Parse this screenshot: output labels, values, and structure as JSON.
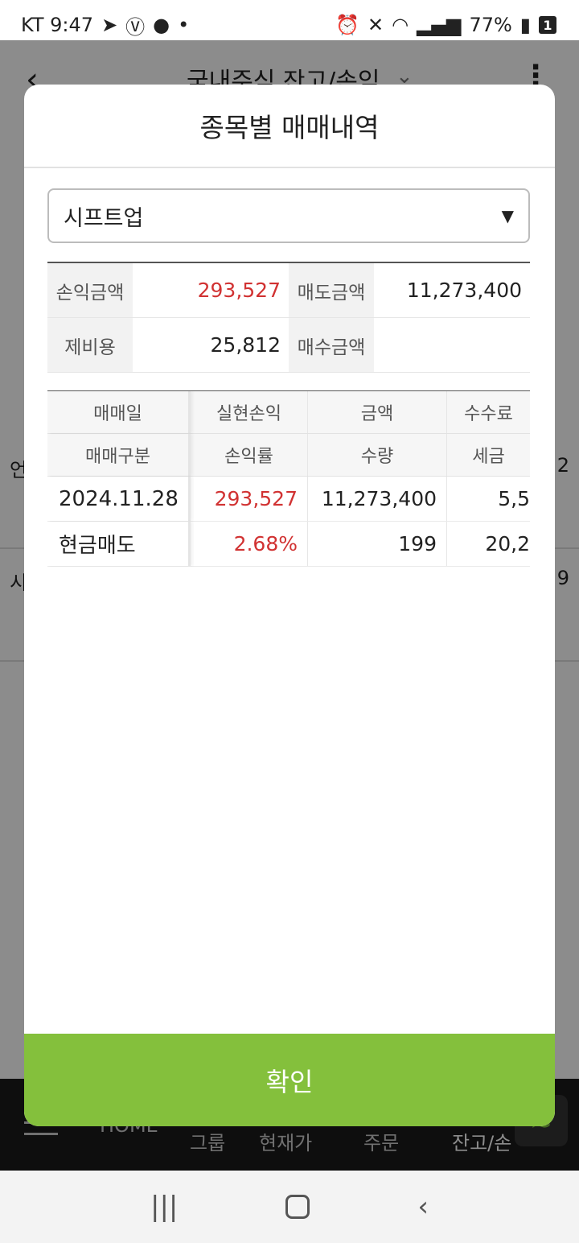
{
  "status_bar": {
    "carrier_time": "KT 9:47",
    "dot": "•",
    "battery": "77%",
    "sim": "1"
  },
  "background_app": {
    "title": "국내주식 잔고/손익",
    "row1_text": "언",
    "row1_num": "2",
    "row2_text": "시",
    "row2_num": "9",
    "nav": {
      "home": "HOME",
      "group": "그룹",
      "price": "현재가",
      "order": "주문",
      "balance": "잔고/손"
    }
  },
  "modal": {
    "title": "종목별 매매내역",
    "stock_select": {
      "value": "시프트업"
    },
    "summary": {
      "profit_label": "손익금액",
      "profit_value": "293,527",
      "sell_label": "매도금액",
      "sell_value": "11,273,400",
      "cost_label": "제비용",
      "cost_value": "25,812",
      "buy_label": "매수금액",
      "buy_value": ""
    },
    "table": {
      "headers_row1": [
        "매매일",
        "실현손익",
        "금액",
        "수수료"
      ],
      "headers_row2": [
        "매매구분",
        "손익률",
        "수량",
        "세금"
      ],
      "rows": [
        {
          "date": "2024.11.28",
          "realized": "293,527",
          "amount": "11,273,400",
          "fee": "5,5",
          "type": "현금매도",
          "rate": "2.68%",
          "qty": "199",
          "tax": "20,2"
        }
      ]
    },
    "confirm_label": "확인"
  },
  "colors": {
    "accent_green": "#84c03c",
    "profit_red": "#d13232"
  },
  "icons": {
    "back": "chevron-left-icon",
    "dropdown": "chevron-down-icon",
    "more": "more-vertical-icon",
    "select_arrow": "triangle-down-icon"
  }
}
